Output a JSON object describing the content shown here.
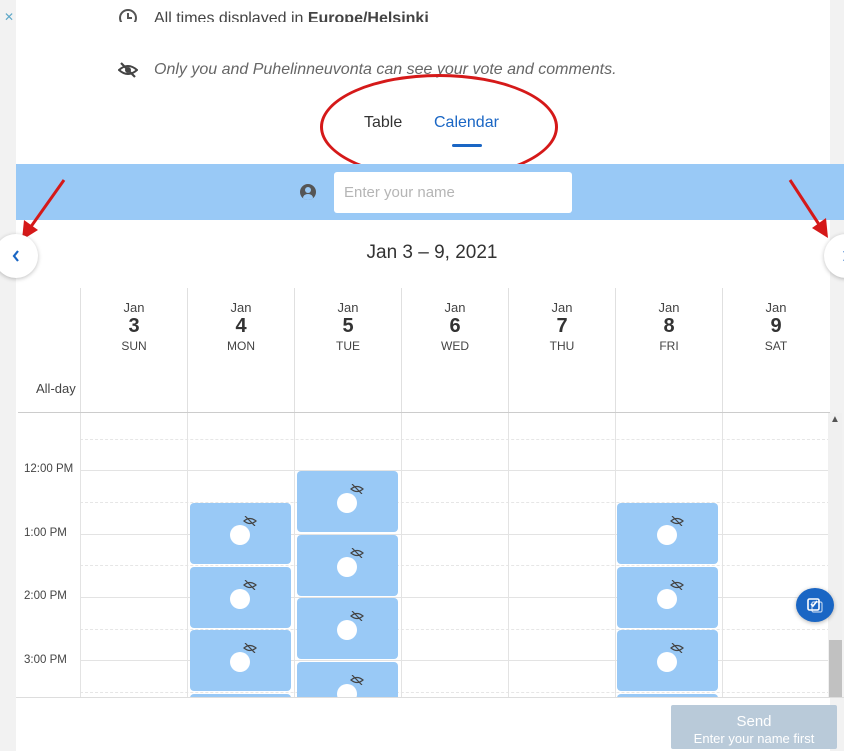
{
  "info": {
    "timezone_prefix": "All times displayed in ",
    "timezone_value": "Europe/Helsinki",
    "privacy_note": "Only you and Puhelinneuvonta can see your vote and comments."
  },
  "tabs": [
    {
      "label": "Table",
      "active": false
    },
    {
      "label": "Calendar",
      "active": true
    }
  ],
  "name_input": {
    "placeholder": "Enter your name",
    "value": ""
  },
  "week": {
    "title": "Jan 3 – 9, 2021"
  },
  "days": [
    {
      "month": "Jan",
      "day": "3",
      "dow": "SUN"
    },
    {
      "month": "Jan",
      "day": "4",
      "dow": "MON"
    },
    {
      "month": "Jan",
      "day": "5",
      "dow": "TUE"
    },
    {
      "month": "Jan",
      "day": "6",
      "dow": "WED"
    },
    {
      "month": "Jan",
      "day": "7",
      "dow": "THU"
    },
    {
      "month": "Jan",
      "day": "8",
      "dow": "FRI"
    },
    {
      "month": "Jan",
      "day": "9",
      "dow": "SAT"
    }
  ],
  "allday_label": "All-day",
  "times": [
    "12:00 PM",
    "1:00 PM",
    "2:00 PM",
    "3:00 PM"
  ],
  "send": {
    "label": "Send",
    "hint": "Enter your name first"
  },
  "colors": {
    "accent": "#1a66c4",
    "slot": "#99c9f6",
    "annotation": "#d51919",
    "send_disabled": "#b9cad9"
  },
  "icons": {
    "timezone": "clock-icon",
    "privacy": "eye-slash-icon",
    "user": "user-circle-icon",
    "prev": "chevron-left-icon",
    "next": "chevron-right-icon",
    "fab": "feedback-icon"
  }
}
